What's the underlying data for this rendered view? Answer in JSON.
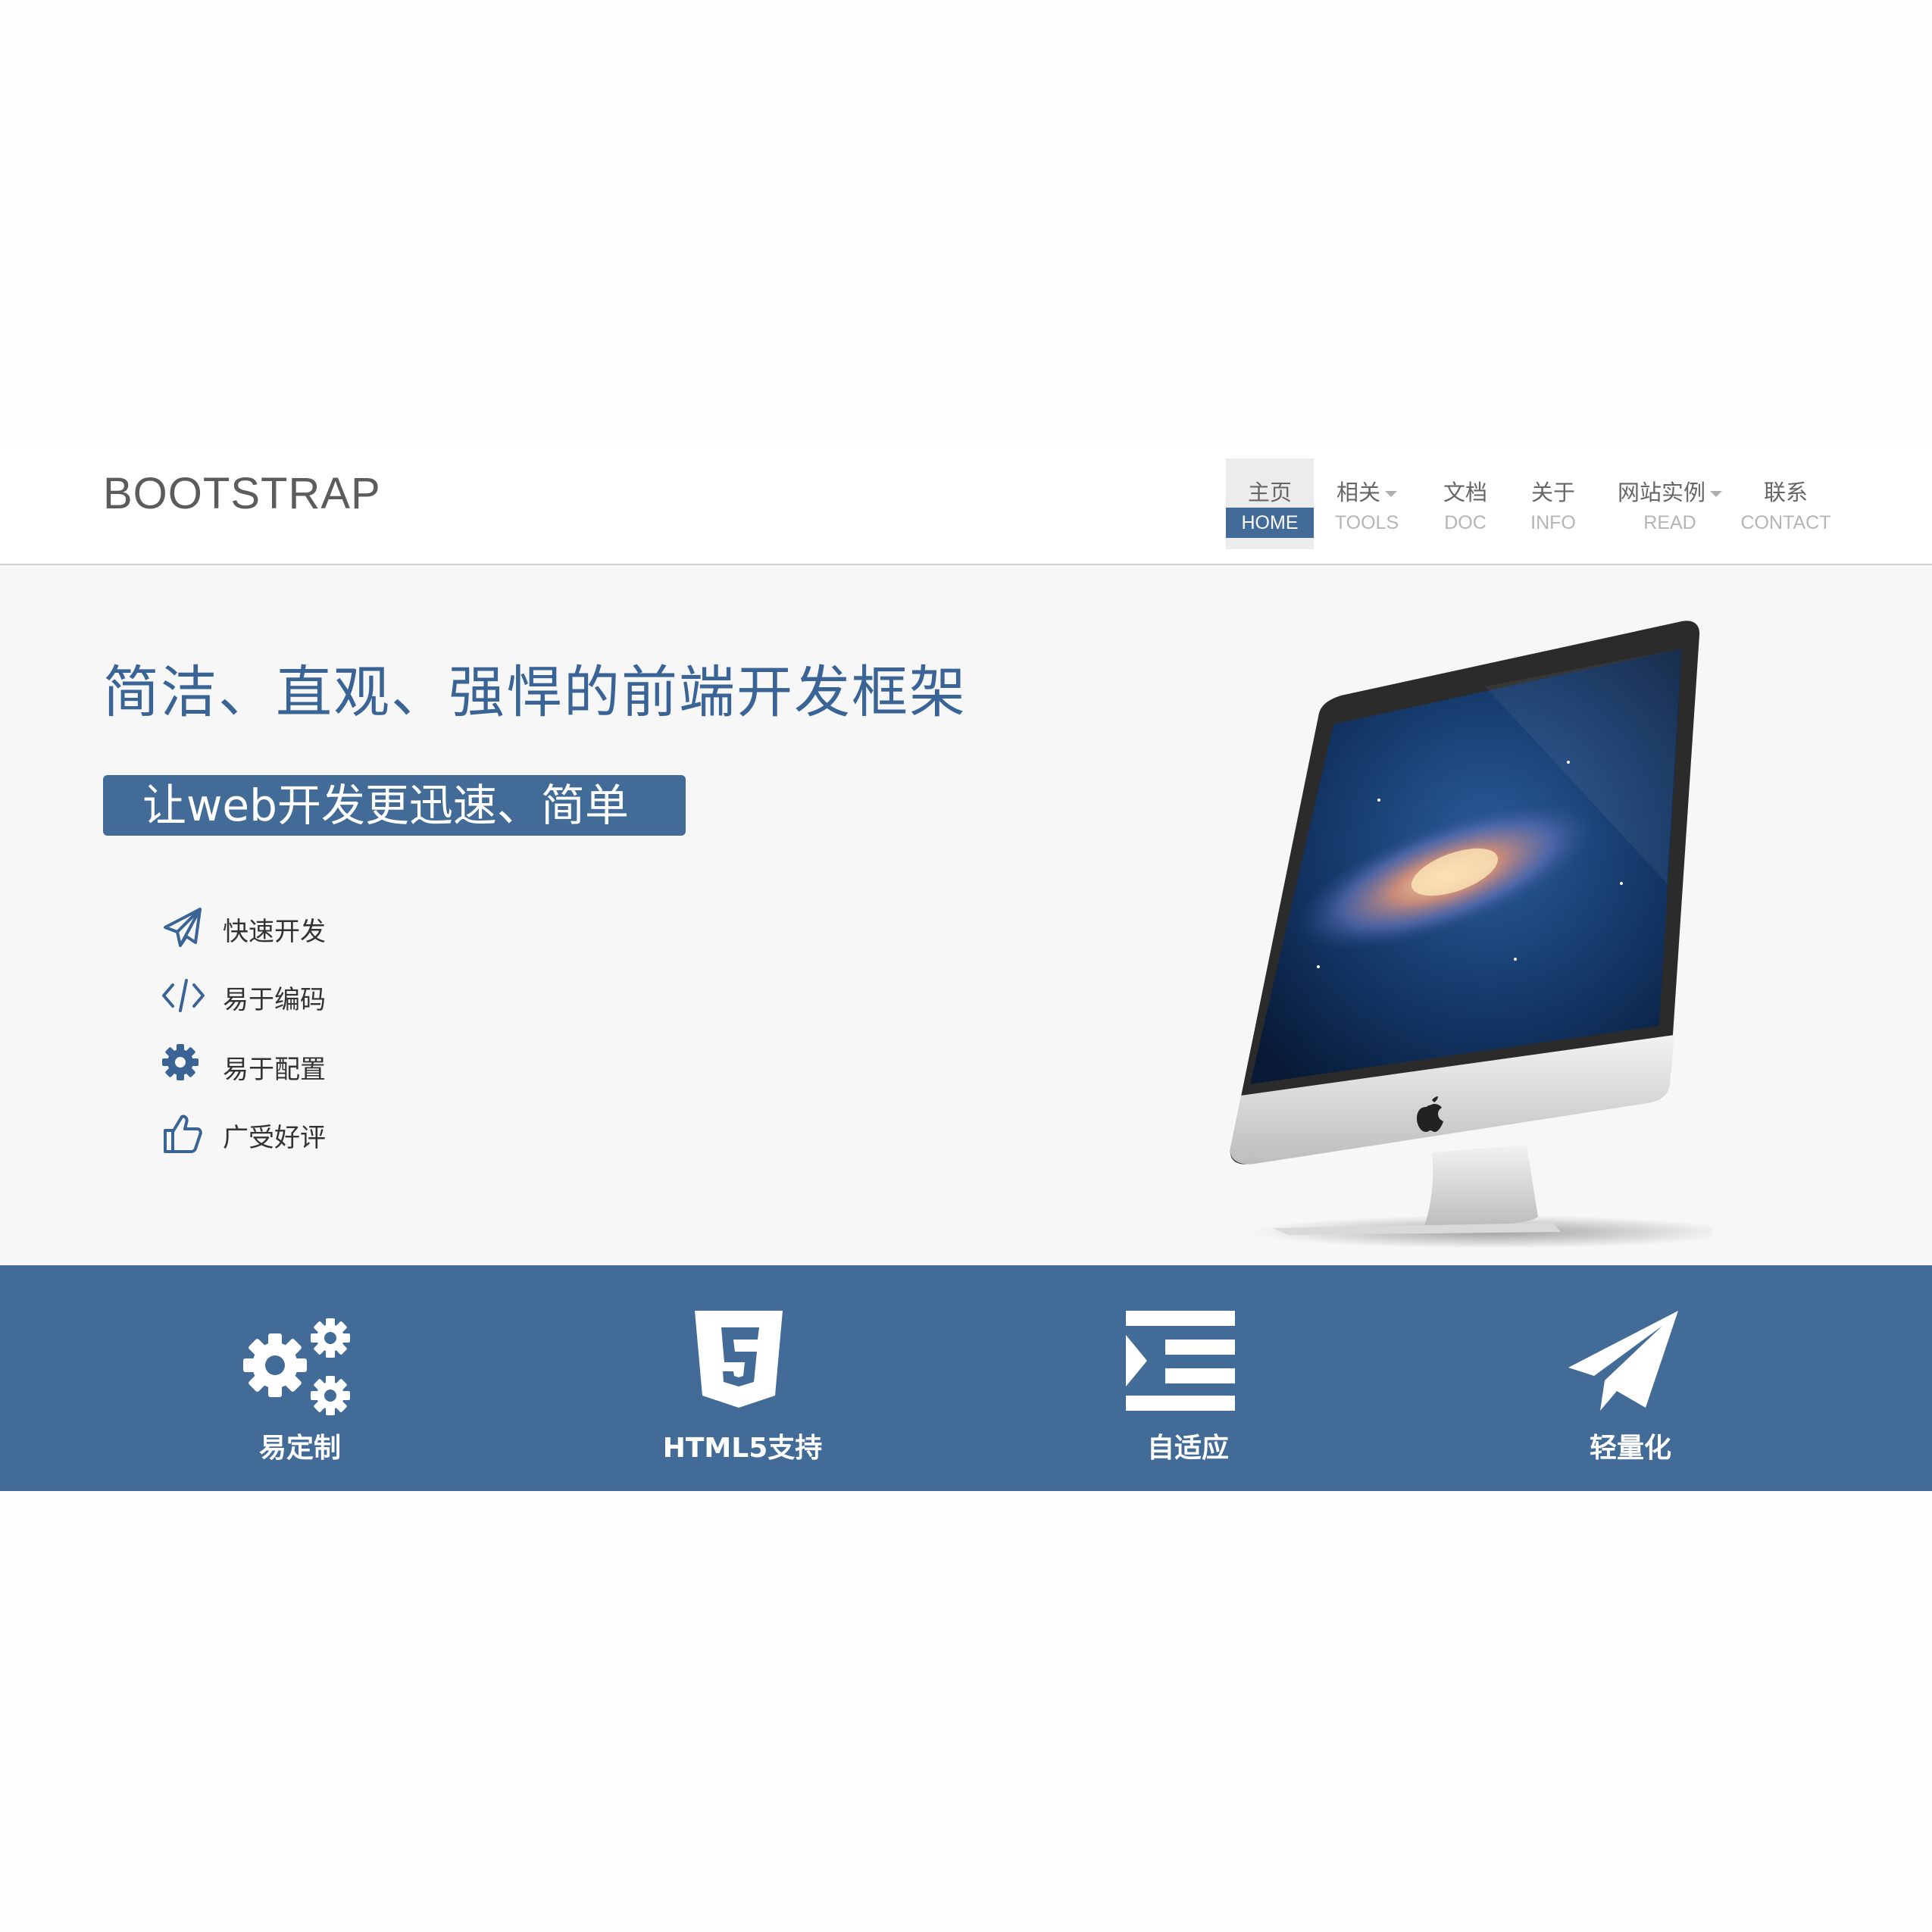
{
  "brand": "BOOTSTRAP",
  "nav": [
    {
      "cn": "主页",
      "en": "HOME"
    },
    {
      "cn": "相关",
      "en": "TOOLS"
    },
    {
      "cn": "文档",
      "en": "DOC"
    },
    {
      "cn": "关于",
      "en": "INFO"
    },
    {
      "cn": "网站实例",
      "en": "READ"
    },
    {
      "cn": "联系",
      "en": "CONTACT"
    }
  ],
  "hero": {
    "headline": "简洁、直观、强悍的前端开发框架",
    "tagline": "让web开发更迅速、简单",
    "features": [
      {
        "label": "快速开发",
        "icon": "paper-plane-icon"
      },
      {
        "label": "易于编码",
        "icon": "code-icon"
      },
      {
        "label": "易于配置",
        "icon": "gear-icon"
      },
      {
        "label": "广受好评",
        "icon": "thumbs-up-icon"
      }
    ]
  },
  "band": [
    {
      "label": "易定制",
      "icon": "gears-icon"
    },
    {
      "label": "HTML5支持",
      "icon": "html5-icon"
    },
    {
      "label": "自适应",
      "icon": "indent-icon"
    },
    {
      "label": "轻量化",
      "icon": "paper-plane-icon"
    }
  ],
  "colors": {
    "accent": "#426b98",
    "hero_bg": "#f7f7f7",
    "nav_active_bg": "#ececec"
  }
}
